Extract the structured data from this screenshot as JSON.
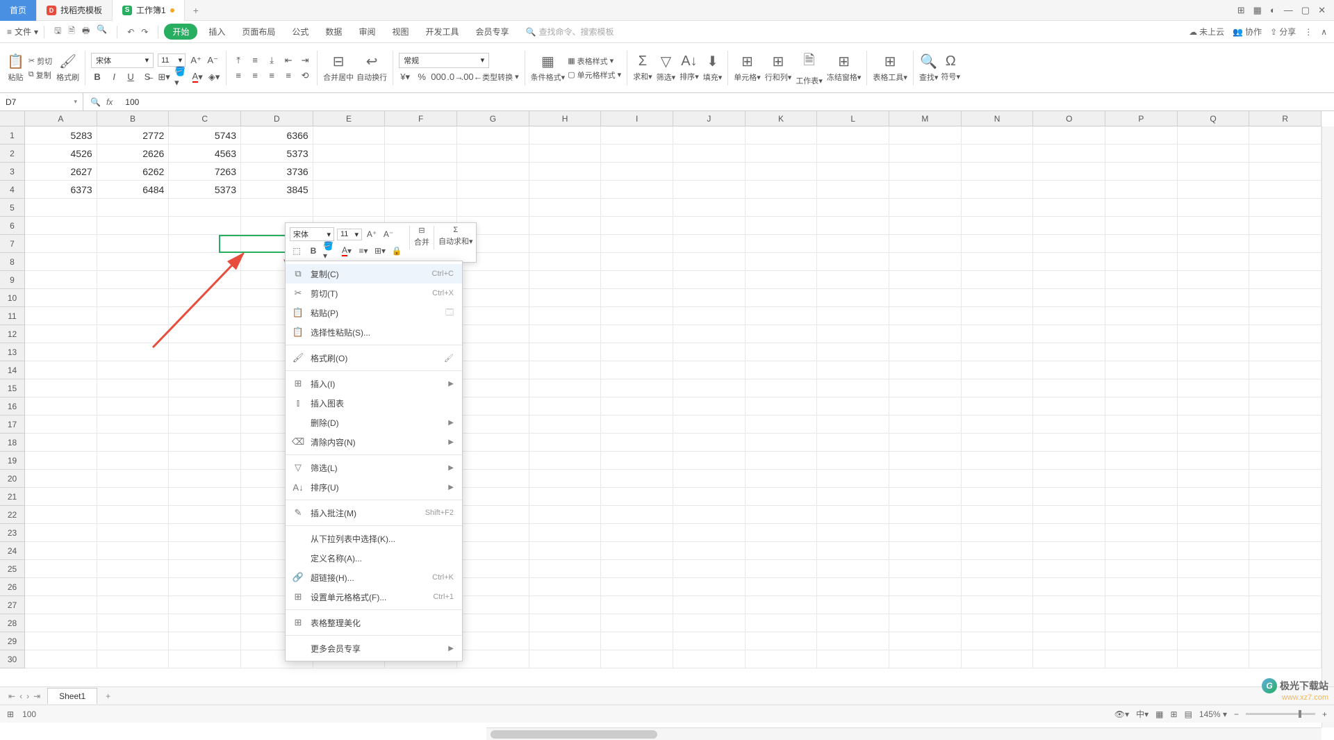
{
  "tabs": {
    "home": "首页",
    "t1": "找稻壳模板",
    "t2": "工作簿1"
  },
  "menubar": {
    "file": "文件",
    "items": [
      "开始",
      "插入",
      "页面布局",
      "公式",
      "数据",
      "审阅",
      "视图",
      "开发工具",
      "会员专享"
    ],
    "search_placeholder": "查找命令、搜索模板",
    "right": {
      "cloud": "未上云",
      "collab": "协作",
      "share": "分享"
    }
  },
  "ribbon": {
    "paste": "粘贴",
    "cut": "剪切",
    "copy": "复制",
    "fmtpaint": "格式刷",
    "font_name": "宋体",
    "font_size": "11",
    "merge": "合并居中",
    "wrap": "自动换行",
    "number_fmt": "常规",
    "type_convert": "类型转换",
    "cond_fmt": "条件格式",
    "table_style": "表格样式",
    "cell_style": "单元格样式",
    "sum": "求和",
    "filter": "筛选",
    "sort": "排序",
    "fill": "填充",
    "cell": "单元格",
    "rowcol": "行和列",
    "worksheet": "工作表",
    "freeze": "冻结窗格",
    "tools": "表格工具",
    "find": "查找",
    "symbol": "符号"
  },
  "formula": {
    "cell_ref": "D7",
    "value": "100"
  },
  "columns": [
    "A",
    "B",
    "C",
    "D",
    "E",
    "F",
    "G",
    "H",
    "I",
    "J",
    "K",
    "L",
    "M",
    "N",
    "O",
    "P",
    "Q",
    "R"
  ],
  "grid": {
    "rows": [
      [
        "5283",
        "2772",
        "5743",
        "6366"
      ],
      [
        "4526",
        "2626",
        "4563",
        "5373"
      ],
      [
        "2627",
        "6262",
        "7263",
        "3736"
      ],
      [
        "6373",
        "6484",
        "5373",
        "3845"
      ],
      [
        "",
        "",
        "",
        ""
      ],
      [
        "",
        "",
        "",
        ""
      ],
      [
        "",
        "",
        "",
        "100"
      ]
    ],
    "max_rows": 30
  },
  "mini_toolbar": {
    "font": "宋体",
    "size": "11",
    "merge": "合并",
    "autosum": "自动求和"
  },
  "context_menu": [
    {
      "icon": "⧉",
      "label": "复制(C)",
      "shortcut": "Ctrl+C",
      "hover": true
    },
    {
      "icon": "✂",
      "label": "剪切(T)",
      "shortcut": "Ctrl+X"
    },
    {
      "icon": "📋",
      "label": "粘贴(P)",
      "right_icon": "🗔"
    },
    {
      "icon": "📋",
      "label": "选择性粘贴(S)..."
    },
    {
      "sep": true
    },
    {
      "icon": "🖌",
      "label": "格式刷(O)",
      "right_icon": "🖌"
    },
    {
      "sep": true
    },
    {
      "icon": "⊞",
      "label": "插入(I)",
      "sub": true
    },
    {
      "icon": "⫾",
      "label": "插入图表"
    },
    {
      "icon": "",
      "label": "删除(D)",
      "sub": true
    },
    {
      "icon": "⌫",
      "label": "清除内容(N)",
      "sub": true
    },
    {
      "sep": true
    },
    {
      "icon": "▽",
      "label": "筛选(L)",
      "sub": true
    },
    {
      "icon": "A↓",
      "label": "排序(U)",
      "sub": true
    },
    {
      "sep": true
    },
    {
      "icon": "✎",
      "label": "插入批注(M)",
      "shortcut": "Shift+F2"
    },
    {
      "sep": true
    },
    {
      "icon": "",
      "label": "从下拉列表中选择(K)..."
    },
    {
      "icon": "",
      "label": "定义名称(A)..."
    },
    {
      "icon": "🔗",
      "label": "超链接(H)...",
      "shortcut": "Ctrl+K"
    },
    {
      "icon": "⊞",
      "label": "设置单元格格式(F)...",
      "shortcut": "Ctrl+1"
    },
    {
      "sep": true
    },
    {
      "icon": "⊞",
      "label": "表格整理美化"
    },
    {
      "sep": true
    },
    {
      "icon": "",
      "label": "更多会员专享",
      "sub": true
    }
  ],
  "sheet": {
    "name": "Sheet1"
  },
  "status": {
    "value": "100",
    "zoom": "145%"
  },
  "watermark": {
    "name": "极光下载站",
    "url": "www.xz7.com"
  }
}
